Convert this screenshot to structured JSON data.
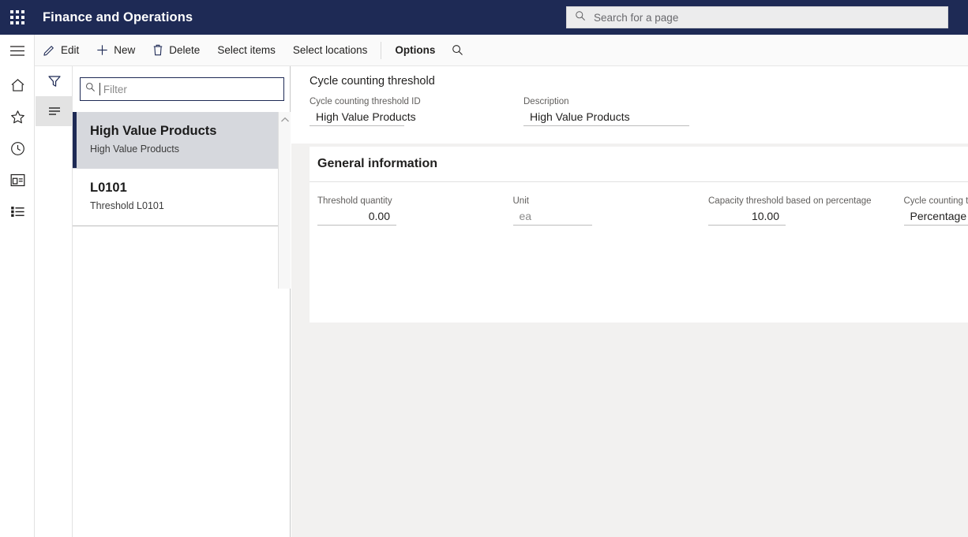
{
  "header": {
    "app_title": "Finance and Operations",
    "waffle_icon": "app-launcher-icon",
    "search": {
      "placeholder": "Search for a page",
      "value": "",
      "icon": "search-icon"
    }
  },
  "command_bar": {
    "buttons": [
      {
        "label": "Edit",
        "icon": "pencil-icon",
        "bold": false
      },
      {
        "label": "New",
        "icon": "plus-icon",
        "bold": false
      },
      {
        "label": "Delete",
        "icon": "trash-icon",
        "bold": false
      },
      {
        "label": "Select items",
        "icon": "",
        "bold": false
      },
      {
        "label": "Select locations",
        "icon": "",
        "bold": false
      },
      {
        "label": "Options",
        "icon": "",
        "bold": true
      }
    ],
    "search_icon": "search-icon"
  },
  "nav_rail": {
    "items": [
      {
        "name": "menu-hamburger",
        "icon": "hamburger-icon"
      },
      {
        "name": "home",
        "icon": "home-icon"
      },
      {
        "name": "favorites",
        "icon": "star-icon"
      },
      {
        "name": "recent",
        "icon": "clock-icon"
      },
      {
        "name": "workspaces",
        "icon": "workspace-icon"
      },
      {
        "name": "modules",
        "icon": "list-icon"
      }
    ]
  },
  "tab_strip": {
    "items": [
      {
        "name": "filter-pane",
        "icon": "funnel-icon",
        "selected": false
      },
      {
        "name": "list-pane",
        "icon": "details-list-icon",
        "selected": true
      }
    ]
  },
  "list_pane": {
    "filter": {
      "placeholder": "Filter",
      "value": "",
      "icon": "search-icon"
    },
    "scroll_up_icon": "chevron-up-icon",
    "items": [
      {
        "title": "High Value Products",
        "subtitle": "High Value Products",
        "selected": true
      },
      {
        "title": "L0101",
        "subtitle": "Threshold L0101",
        "selected": false
      }
    ]
  },
  "main": {
    "page_title": "Cycle counting threshold",
    "header_fields": [
      {
        "label": "Cycle counting threshold ID",
        "value": "High Value Products",
        "placeholder": false
      },
      {
        "label": "Description",
        "value": "High Value Products",
        "placeholder": false
      }
    ],
    "fast_tab": {
      "title": "General information",
      "fields": [
        {
          "label": "Threshold quantity",
          "value": "0.00",
          "align": "right",
          "placeholder": false
        },
        {
          "label": "Unit",
          "value": "ea",
          "align": "left",
          "placeholder": true
        },
        {
          "label": "Capacity threshold based on percentage",
          "value": "10.00",
          "align": "right",
          "placeholder": false
        },
        {
          "label": "Cycle counting threshold type",
          "value": "Percentage",
          "align": "left",
          "placeholder": false
        }
      ]
    }
  },
  "colors": {
    "brand_navy": "#1e2a55",
    "page_background": "#f2f1f0",
    "card_background": "#ffffff",
    "selection_gray": "#d6d8dd",
    "label_gray": "#605e5c"
  }
}
